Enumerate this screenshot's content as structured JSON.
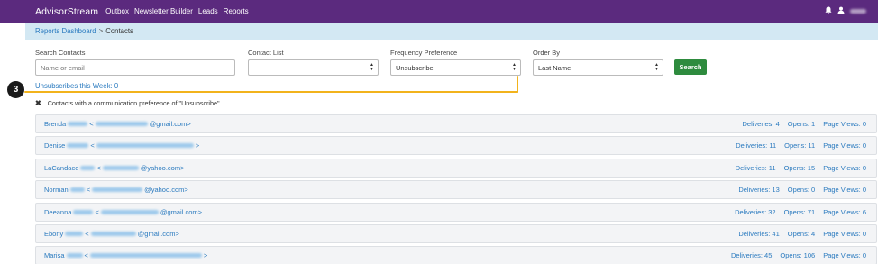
{
  "navbar": {
    "brand": "AdvisorStream",
    "links": [
      "Outbox",
      "Newsletter Builder",
      "Leads",
      "Reports"
    ],
    "icons": [
      "bell-icon",
      "user-icon"
    ],
    "bg_color": "#5b2a7e"
  },
  "breadcrumb": {
    "parent": "Reports Dashboard",
    "separator": ">",
    "current": "Contacts"
  },
  "filters": {
    "search_label": "Search Contacts",
    "search_placeholder": "Name or email",
    "list_label": "Contact List",
    "list_value": "",
    "frequency_label": "Frequency Preference",
    "frequency_value": "Unsubscribe",
    "order_label": "Order By",
    "order_value": "Last Name",
    "search_button": "Search",
    "button_color": "#2e8b3e"
  },
  "callout": {
    "badge": "3",
    "color": "#f2b31c"
  },
  "unsubscribes_week": "Unsubscribes this Week: 0",
  "notice": {
    "close_icon": "times-icon",
    "text": "Contacts with a communication preference of \"Unsubscribe\"."
  },
  "contacts": [
    {
      "first": "Brenda",
      "domain": "@gmail.com>",
      "deliveries": "Deliveries: 4",
      "opens": "Opens: 1",
      "views": "Page Views: 0"
    },
    {
      "first": "Denise",
      "domain": ">",
      "deliveries": "Deliveries: 11",
      "opens": "Opens: 11",
      "views": "Page Views: 0"
    },
    {
      "first": "LaCandace",
      "domain": "@yahoo.com>",
      "deliveries": "Deliveries: 11",
      "opens": "Opens: 15",
      "views": "Page Views: 0"
    },
    {
      "first": "Norman",
      "domain": "@yahoo.com>",
      "deliveries": "Deliveries: 13",
      "opens": "Opens: 0",
      "views": "Page Views: 0"
    },
    {
      "first": "Deeanna",
      "domain": "@gmail.com>",
      "deliveries": "Deliveries: 32",
      "opens": "Opens: 71",
      "views": "Page Views: 6"
    },
    {
      "first": "Ebony",
      "domain": "@gmail.com>",
      "deliveries": "Deliveries: 41",
      "opens": "Opens: 4",
      "views": "Page Views: 0"
    },
    {
      "first": "Marisa",
      "domain": ">",
      "deliveries": "Deliveries: 45",
      "opens": "Opens: 106",
      "views": "Page Views: 0"
    }
  ]
}
